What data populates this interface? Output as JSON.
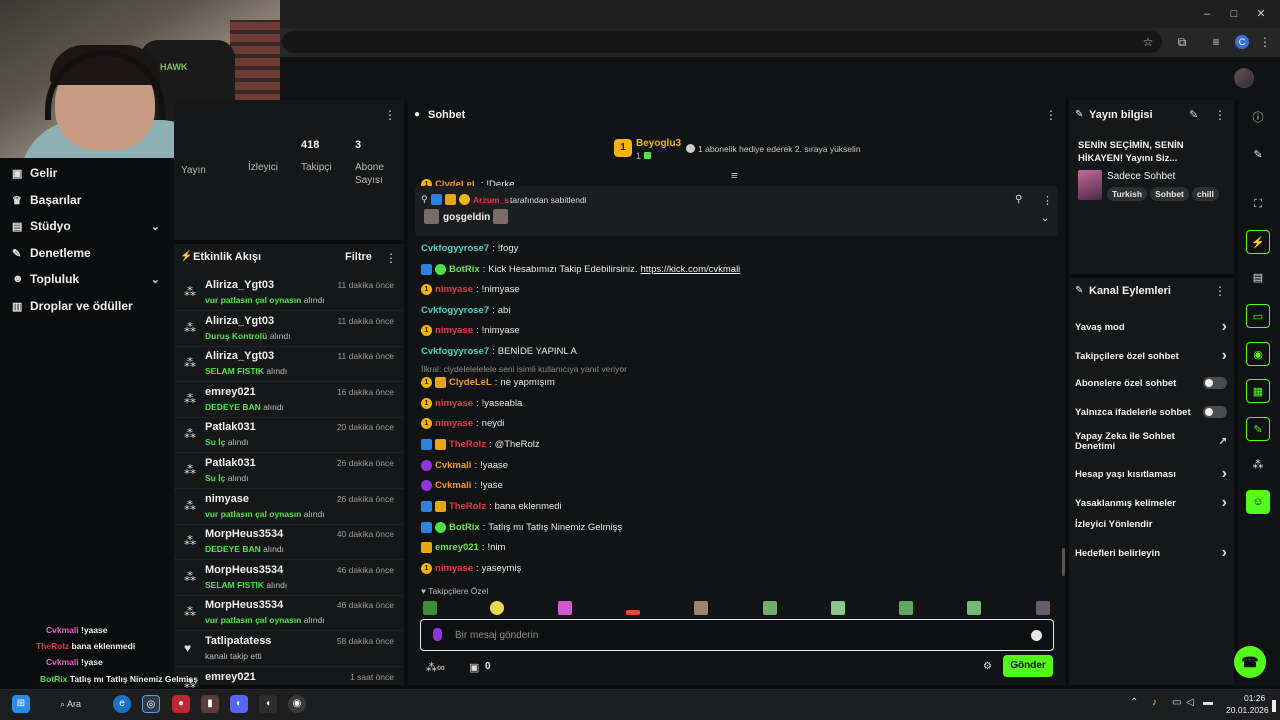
{
  "window": {
    "minimize": "–",
    "maximize": "□",
    "close": "✕"
  },
  "toolbar": {
    "profile_letter": "C"
  },
  "webcam": {
    "chair_logo": "HAWK"
  },
  "nav": {
    "items": [
      {
        "label": "Gelir",
        "icon": "wallet-icon"
      },
      {
        "label": "Başarılar",
        "icon": "trophy-icon"
      },
      {
        "label": "Stüdyo",
        "icon": "studio-icon"
      },
      {
        "label": "Denetleme",
        "icon": "wrench-icon"
      },
      {
        "label": "Topluluk",
        "icon": "community-icon"
      },
      {
        "label": "Droplar ve ödüller",
        "icon": "drops-icon"
      }
    ]
  },
  "stats": {
    "items": [
      {
        "value": "",
        "label": "Yayın"
      },
      {
        "value": "",
        "label": "İzleyici"
      },
      {
        "value": "418",
        "label": "Takipçi"
      },
      {
        "value": "3",
        "label": "Abone Sayısı"
      }
    ]
  },
  "feed": {
    "title": "Etkinlik Akışı",
    "filter": "Filtre",
    "rows": [
      {
        "name": "Aliriza_Ygt03",
        "time": "11 dakika önce",
        "reward": "vur patlasın çal oynasın",
        "suffix": "alındı"
      },
      {
        "name": "Aliriza_Ygt03",
        "time": "11 dakika önce",
        "reward": "Duruş Kontrolü",
        "suffix": "alındı"
      },
      {
        "name": "Aliriza_Ygt03",
        "time": "11 dakika önce",
        "reward": "SELAM FISTIK",
        "suffix": "alındı"
      },
      {
        "name": "emrey021",
        "time": "16 dakika önce",
        "reward": "DEDEYE BAN",
        "suffix": "alındı"
      },
      {
        "name": "Patlak031",
        "time": "20 dakika önce",
        "reward": "Su İç",
        "suffix": "alındı"
      },
      {
        "name": "Patlak031",
        "time": "26 dakika önce",
        "reward": "Su İç",
        "suffix": "alındı"
      },
      {
        "name": "nimyase",
        "time": "26 dakika önce",
        "reward": "vur patlasın çal oynasın",
        "suffix": "alındı"
      },
      {
        "name": "MorpHeus3534",
        "time": "40 dakika önce",
        "reward": "DEDEYE BAN",
        "suffix": "alındı"
      },
      {
        "name": "MorpHeus3534",
        "time": "46 dakika önce",
        "reward": "SELAM FISTIK",
        "suffix": "alındı"
      },
      {
        "name": "MorpHeus3534",
        "time": "46 dakika önce",
        "reward": "vur patlasın çal oynasın",
        "suffix": "alındı"
      },
      {
        "name": "Tatlipatatess",
        "time": "58 dakika önce",
        "reward": "",
        "suffix": "kanalı takip etti"
      },
      {
        "name": "emrey021",
        "time": "1 saat önce",
        "reward": "",
        "suffix": ""
      }
    ]
  },
  "overlay_chat": [
    {
      "user": "Cvkmali",
      "msg": "!yaase"
    },
    {
      "user": "TheRolz",
      "msg": "bana eklenmedi"
    },
    {
      "user": "Cvkmali",
      "msg": "!yase"
    },
    {
      "user": "BotRix",
      "msg": "Tatlış mı Tatlış Ninemiz Gelmişş"
    },
    {
      "user": "emrey021",
      "msg": "!nim"
    },
    {
      "user": "yaseymiş",
      "msg": ""
    }
  ],
  "chat": {
    "title": "Sohbet",
    "gift": {
      "user": "Beyoglu3",
      "count": "1",
      "rank": "1",
      "text": "1 abonelik hediye ederek 2. sıraya yükselin"
    },
    "clipped_top": {
      "user": "ClydeLeL",
      "msg": "!Derke"
    },
    "pinned": {
      "by_user": "Arzum_s",
      "by_text": "tarafından sabitlendi",
      "message": "goşgeldin"
    },
    "reply_hint": "İlkral: clydelelelelele seni isimli kullanıcıya yanıt veriyor",
    "messages": [
      {
        "user": "Cvkfogyyrose7",
        "msg": "!fogy",
        "link": ""
      },
      {
        "user": "BotRix",
        "msg": "Kick Hesabımızı Takip Edebilirsiniz.",
        "link": "https://kick.com/cvkmali"
      },
      {
        "user": "nimyase",
        "msg": "!nimyase",
        "link": ""
      },
      {
        "user": "Cvkfogyyrose7",
        "msg": "abi",
        "link": ""
      },
      {
        "user": "nimyase",
        "msg": "!nimyase",
        "link": ""
      },
      {
        "user": "Cvkfogyyrose7",
        "msg": "BENİDE YAPINL A",
        "link": ""
      },
      {
        "user": "ClydeLeL",
        "msg": "ne yapmışım",
        "link": ""
      },
      {
        "user": "nimyase",
        "msg": "!yaseabla",
        "link": ""
      },
      {
        "user": "nimyase",
        "msg": "neydi",
        "link": ""
      },
      {
        "user": "TheRolz",
        "msg": "@TheRolz",
        "link": ""
      },
      {
        "user": "Cvkmali",
        "msg": "!yaase",
        "link": ""
      },
      {
        "user": "Cvkmali",
        "msg": "!yase",
        "link": ""
      },
      {
        "user": "TheRolz",
        "msg": "bana eklenmedi",
        "link": ""
      },
      {
        "user": "BotRix",
        "msg": "Tatlış mı Tatlış Ninemiz Gelmişş",
        "link": ""
      },
      {
        "user": "emrey021",
        "msg": "!nim",
        "link": ""
      },
      {
        "user": "nimyase",
        "msg": "yaseymiş",
        "link": ""
      }
    ],
    "follow_only": "Takipçilere Özel",
    "input_placeholder": "Bir mesaj gönderin",
    "points": "0",
    "send": "Gönder"
  },
  "info": {
    "title": "Yayın bilgisi",
    "stream_title": "SENİN SEÇİMİN, SENİN HİKAYEN! Yayını Siz...",
    "category": "Sadece Sohbet",
    "tags": [
      "Turkish",
      "Sohbet",
      "chill"
    ]
  },
  "actions": {
    "title": "Kanal Eylemleri",
    "rows": [
      {
        "label": "Yavaş mod",
        "control": "chevron"
      },
      {
        "label": "Takipçilere özel sohbet",
        "control": "chevron"
      },
      {
        "label": "Abonelere özel sohbet",
        "control": "toggle"
      },
      {
        "label": "Yalnızca ifadelerle sohbet",
        "control": "toggle"
      },
      {
        "label": "Yapay Zeka ile Sohbet Denetimi",
        "control": "external"
      },
      {
        "label": "Hesap yaşı kısıtlaması",
        "control": "chevron"
      },
      {
        "label": "Yasaklanmış kelimeler",
        "control": "chevron"
      },
      {
        "label": "İzleyici Yönlendir",
        "control": "none"
      },
      {
        "label": "Hedefleri belirleyin",
        "control": "chevron"
      }
    ]
  },
  "taskbar": {
    "search": "Ara",
    "time": "01:26",
    "date": "20.01.2026"
  },
  "colors": {
    "accent": "#53fc18",
    "gold": "#f2b40c",
    "panel": "#161718"
  }
}
